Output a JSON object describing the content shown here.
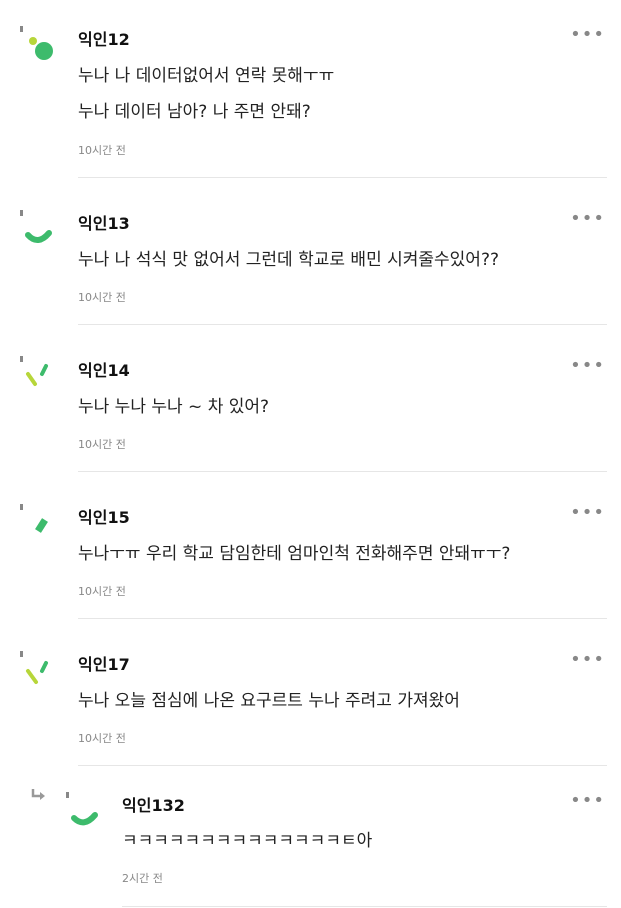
{
  "comments": [
    {
      "user": "익인12",
      "lines": [
        "누나 나 데이터없어서 연락 못해ㅜㅠ",
        "누나 데이터 남아? 나 주면 안돼?"
      ],
      "time": "10시간 전"
    },
    {
      "user": "익인13",
      "lines": [
        "누나 나 석식 맛 없어서 그런데 학교로 배민 시켜줄수있어??"
      ],
      "time": "10시간 전"
    },
    {
      "user": "익인14",
      "lines": [
        "누나 누나 누나 ~ 차 있어?"
      ],
      "time": "10시간 전"
    },
    {
      "user": "익인15",
      "lines": [
        "누나ㅜㅠ 우리 학교 담임한테 엄마인척 전화해주면 안돼ㅠㅜ?"
      ],
      "time": "10시간 전"
    },
    {
      "user": "익인17",
      "lines": [
        "누나 오늘 점심에 나온 요구르트 누나 주려고 가져왔어"
      ],
      "time": "10시간 전"
    }
  ],
  "reply": {
    "user": "익인132",
    "lines": [
      "ㅋㅋㅋㅋㅋㅋㅋㅋㅋㅋㅋㅋㅋㅋㅌ아"
    ],
    "time": "2시간 전"
  },
  "more_label": "•••",
  "colors": {
    "accent": "#3dbb6c",
    "lime": "#b7d63a"
  }
}
